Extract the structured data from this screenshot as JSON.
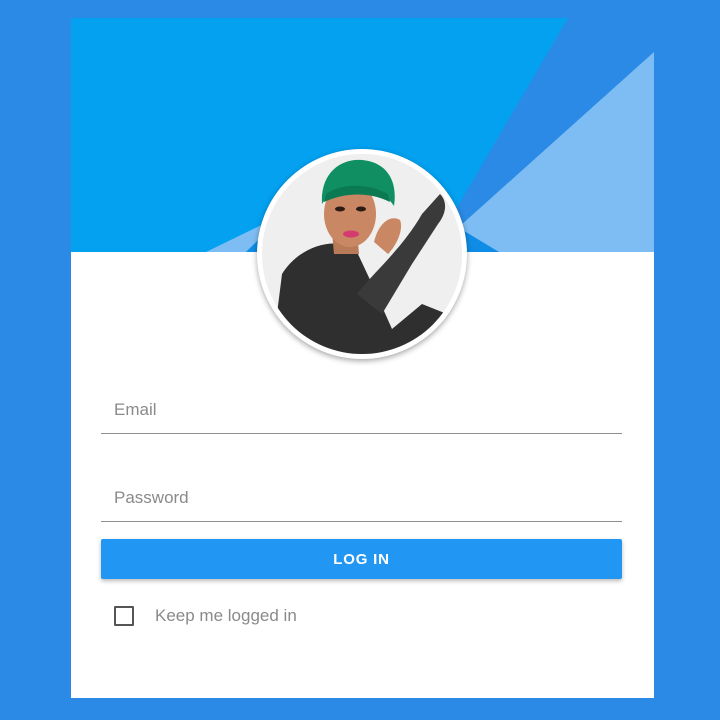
{
  "colors": {
    "page_background": "#2a8ae6",
    "header_primary": "#03a1f0",
    "header_accent_dark": "#2a8ae6",
    "header_accent_light": "#7dbdf3",
    "button": "#2196f3"
  },
  "profile": {
    "avatar_icon": "user-photo"
  },
  "form": {
    "email_placeholder": "Email",
    "password_placeholder": "Password",
    "login_label": "LOG IN",
    "remember_label": "Keep me logged in",
    "remember_checked": false
  }
}
